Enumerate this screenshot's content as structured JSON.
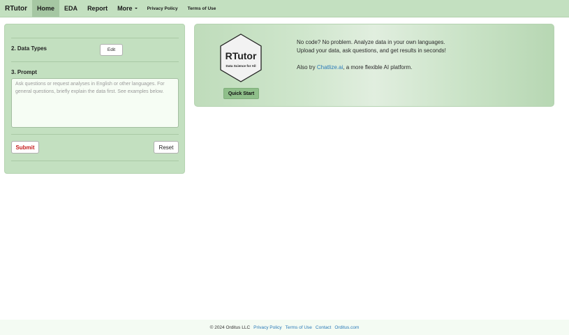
{
  "navbar": {
    "brand": "RTutor",
    "items": [
      {
        "label": "Home",
        "active": true
      },
      {
        "label": "EDA"
      },
      {
        "label": "Report"
      },
      {
        "label": "More"
      },
      {
        "label": "Privacy Policy"
      },
      {
        "label": "Terms of Use"
      }
    ]
  },
  "left_panel": {
    "data_types_label": "2. Data Types",
    "edit_button": "Edit",
    "prompt_label": "3. Prompt",
    "prompt_placeholder": "Ask questions or request analyses in English or other languages. For general questions, briefly explain the data first. See examples below.",
    "prompt_value": "",
    "submit_button": "Submit",
    "reset_button": "Reset"
  },
  "banner": {
    "logo_title": "RTutor",
    "logo_subtitle": "Data Science for All",
    "quick_start_button": "Quick Start",
    "line1": "No code? No problem. Analyze data in your own languages.",
    "line2": "Upload your data, ask questions, and get results in seconds!",
    "line3_prefix": "Also try ",
    "line3_link": "Chatlize.ai",
    "line3_suffix": ", a more flexible AI platform."
  },
  "footer": {
    "copyright": "© 2024 Orditus LLC",
    "links": [
      "Privacy Policy",
      "Terms of Use",
      "Contact",
      "Orditus.com"
    ]
  },
  "colors": {
    "navbar_bg": "#c3e0c0",
    "active_tab_bg": "#a6c7a3",
    "panel_bg": "#c3e0c0",
    "submit_text": "#c41b1b",
    "link": "#2a7ab8",
    "quick_start_bg": "#8fbf8a"
  }
}
